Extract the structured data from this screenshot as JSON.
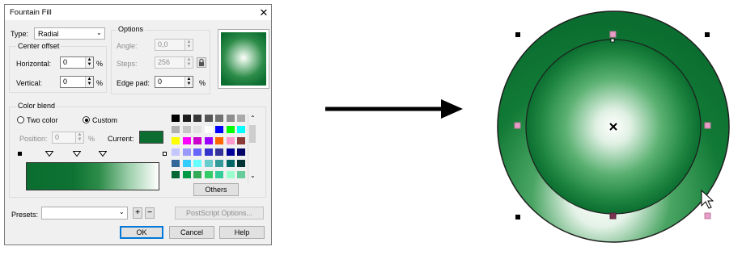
{
  "dialog": {
    "title": "Fountain Fill",
    "close_glyph": "✕",
    "type_label": "Type:",
    "type_value": "Radial",
    "center_offset_title": "Center offset",
    "horizontal_label": "Horizontal:",
    "horizontal_value": "0",
    "vertical_label": "Vertical:",
    "vertical_value": "0",
    "percent": "%",
    "options_title": "Options",
    "angle_label": "Angle:",
    "angle_value": "0,0",
    "steps_label": "Steps:",
    "steps_value": "256",
    "edge_pad_label": "Edge pad:",
    "edge_pad_value": "0",
    "color_blend_title": "Color blend",
    "two_color_label": "Two color",
    "custom_label": "Custom",
    "position_label": "Position:",
    "position_value": "0",
    "current_label": "Current:",
    "current_color": "#0b6e30",
    "others_label": "Others",
    "presets_label": "Presets:",
    "presets_value": "",
    "postscript_label": "PostScript Options...",
    "ok_label": "OK",
    "cancel_label": "Cancel",
    "help_label": "Help"
  },
  "palette": [
    "#000000",
    "#1c1c1c",
    "#383838",
    "#555555",
    "#717171",
    "#8d8d8d",
    "#aaaaaa",
    "#b0b0b0",
    "#c6c6c6",
    "#e2e2e2",
    "#ffffff",
    "#0000ff",
    "#00ff00",
    "#00ffff",
    "#ffff00",
    "#ff00ff",
    "#cc00cc",
    "#9900ff",
    "#ff6600",
    "#ff99cc",
    "#8b3a3a",
    "#c6c6ff",
    "#9999ff",
    "#6666ff",
    "#3333cc",
    "#333399",
    "#000099",
    "#000066",
    "#336699",
    "#33ccff",
    "#66ffff",
    "#66cccc",
    "#339999",
    "#006666",
    "#003333",
    "#006633",
    "#009944",
    "#33aa55",
    "#33cc66",
    "#33cc99",
    "#99ffcc",
    "#66cc99"
  ],
  "colors": {
    "gradient_dark": "#0b6e30",
    "gradient_light": "#ffffff",
    "outer_circle": "#117a36",
    "arrow": "#000000"
  }
}
